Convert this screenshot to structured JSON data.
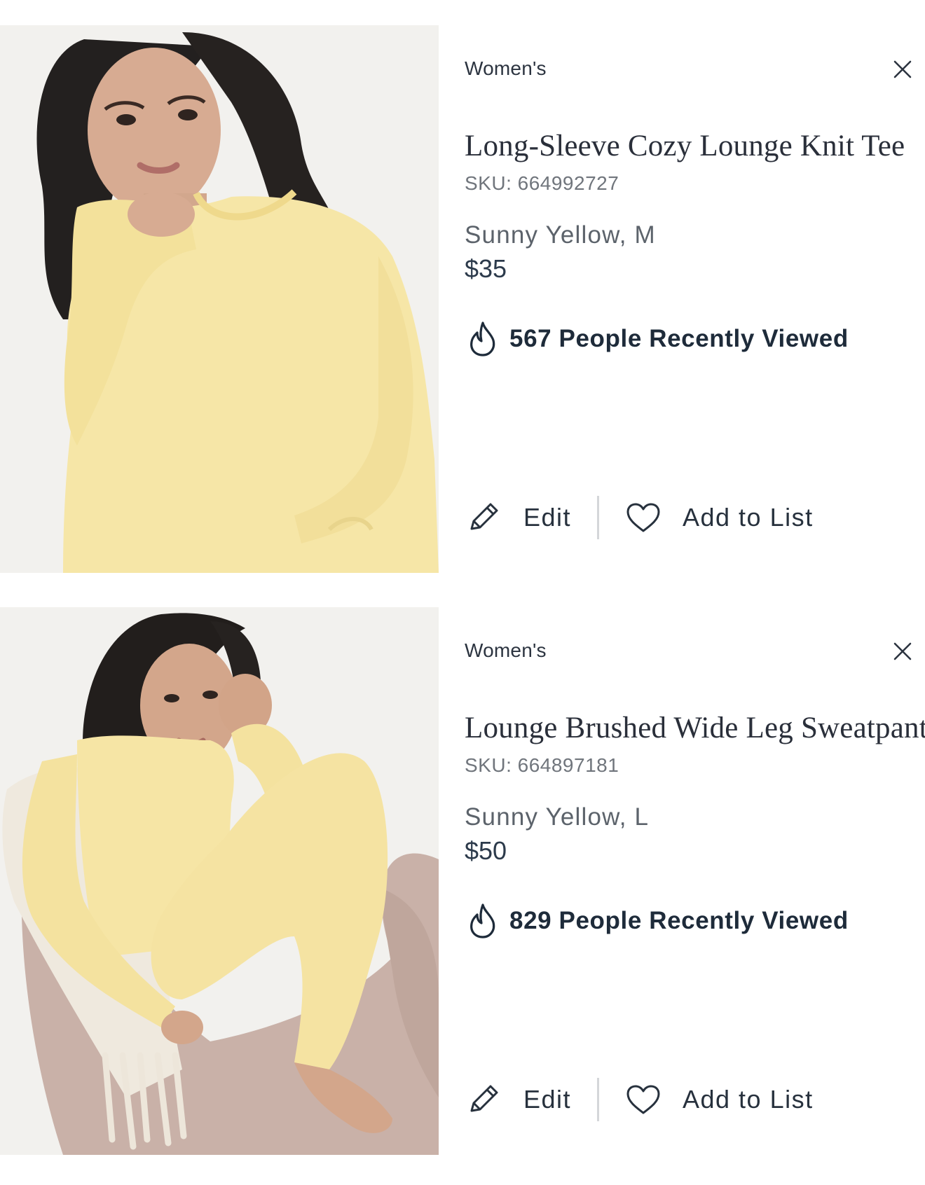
{
  "cart_items": [
    {
      "category": "Women's",
      "title": "Long-Sleeve Cozy Lounge Knit Tee",
      "sku": "SKU: 664992727",
      "variant": "Sunny Yellow, M",
      "price": "$35",
      "recent_views": "567 People Recently Viewed",
      "edit_label": "Edit",
      "add_to_list_label": "Add to List",
      "remove_icon": "close-icon"
    },
    {
      "category": "Women's",
      "title": "Lounge Brushed Wide Leg Sweatpant",
      "sku": "SKU: 664897181",
      "variant": "Sunny Yellow, L",
      "price": "$50",
      "recent_views": "829 People Recently Viewed",
      "edit_label": "Edit",
      "add_to_list_label": "Add to List",
      "remove_icon": "close-icon"
    }
  ],
  "colors": {
    "product_yellow": "#f7e7a8",
    "text_dark": "#1e2b3a",
    "divider": "#d4d6d9"
  }
}
